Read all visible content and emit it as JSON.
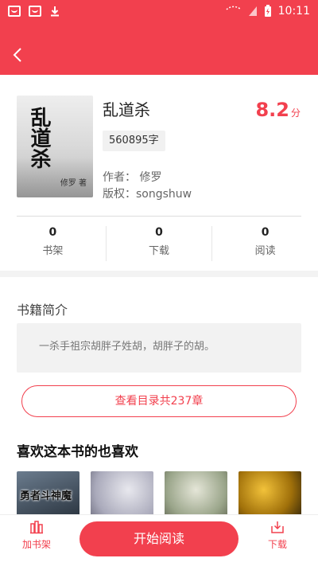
{
  "status_bar": {
    "time": "10:11"
  },
  "book": {
    "title": "乱道杀",
    "score": "8.2",
    "score_unit": "分",
    "word_count": "560895字",
    "author_line": "作者：  修罗",
    "copyright_line": "版权：songshuw",
    "cover_title": "乱道杀",
    "cover_author": "修罗 著"
  },
  "stats": [
    {
      "count": "0",
      "label": "书架"
    },
    {
      "count": "0",
      "label": "下载"
    },
    {
      "count": "0",
      "label": "阅读"
    }
  ],
  "intro": {
    "heading": "书籍简介",
    "text": "一杀手祖宗胡胖子姓胡，胡胖子的胡。"
  },
  "catalog_button": "查看目录共237章",
  "recommend": {
    "heading": "喜欢这本书的也喜欢",
    "first_cover_title": "勇者斗神魔"
  },
  "bottom_bar": {
    "add_shelf": "加书架",
    "start_reading": "开始阅读",
    "download": "下载"
  },
  "colors": {
    "accent": "#f2404e"
  }
}
